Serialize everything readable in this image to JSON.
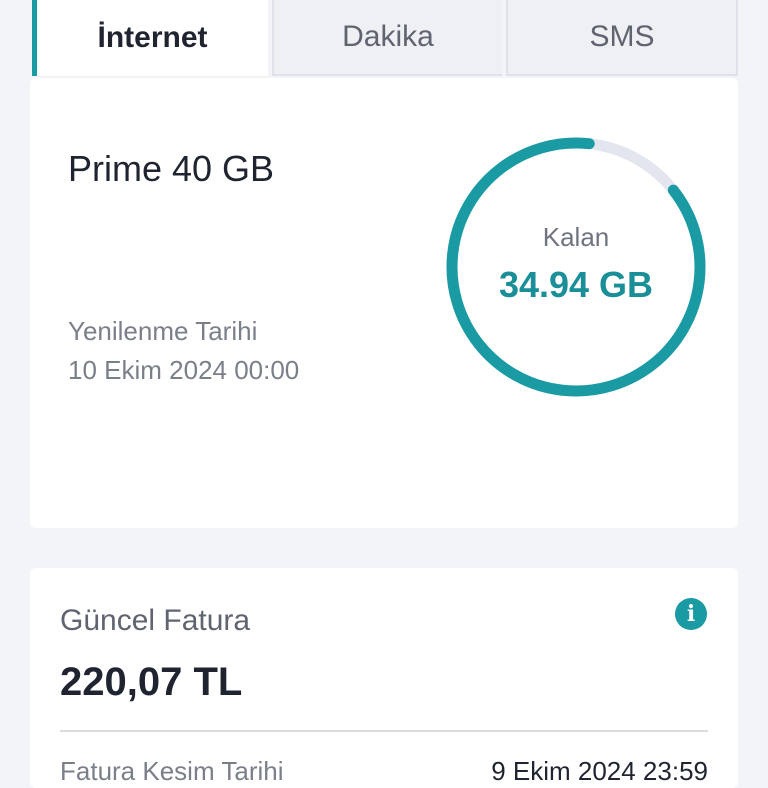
{
  "tabs": [
    {
      "label": "İnternet",
      "active": true
    },
    {
      "label": "Dakika",
      "active": false
    },
    {
      "label": "SMS",
      "active": false
    }
  ],
  "package": {
    "name": "Prime 40 GB",
    "renew_label": "Yenilenme Tarihi",
    "renew_date": "10 Ekim 2024 00:00",
    "remaining_label": "Kalan",
    "remaining_value": "34.94 GB",
    "remaining_fraction": 0.873
  },
  "bill": {
    "title": "Güncel Fatura",
    "amount": "220,07 TL",
    "info_icon": "info-icon",
    "cutoff_label": "Fatura Kesim Tarihi",
    "cutoff_value": "9 Ekim 2024 23:59"
  },
  "colors": {
    "accent": "#1a9aa3",
    "track": "#e3e6ef"
  }
}
